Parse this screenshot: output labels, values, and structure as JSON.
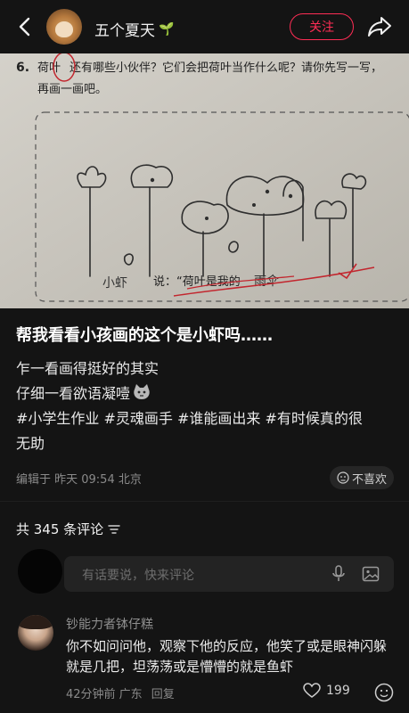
{
  "header": {
    "username": "五个夏天",
    "follow_label": "关注"
  },
  "photo": {
    "worksheet_line1": "还有哪些小伙伴？它们会把荷叶当作什么呢？请你先写一写，",
    "worksheet_line1_prefix": "荷叶",
    "worksheet_line2": "再画一画吧。",
    "question_number": "6.",
    "handwriting_left": "小虾",
    "handwriting_said": "说：“荷叶是我的",
    "handwriting_right": "雨伞"
  },
  "post": {
    "title": "帮我看看小孩画的这个是小虾吗……",
    "line1": "乍一看画得挺好的其实",
    "line2": "仔细一看欲语凝噎",
    "tags_line1": "#小学生作业 #灵魂画手 #谁能画出来 #有时候真的很",
    "tags_line2": "无助",
    "meta": "编辑于 昨天 09:54 北京",
    "dislike_label": "不喜欢"
  },
  "comments": {
    "count_label": "共 345 条评论",
    "input_placeholder": "有话要说，快来评论",
    "items": [
      {
        "name": "钞能力者钵仔糕",
        "text": "你不如问问他，观察下他的反应，他笑了或是眼神闪躲就是几把，坦荡荡或是懵懵的就是鱼虾",
        "time": "42分钟前 广东",
        "reply": "回复",
        "likes": "199"
      }
    ]
  },
  "colors": {
    "background": "#141414",
    "accent": "#ff2d55"
  }
}
